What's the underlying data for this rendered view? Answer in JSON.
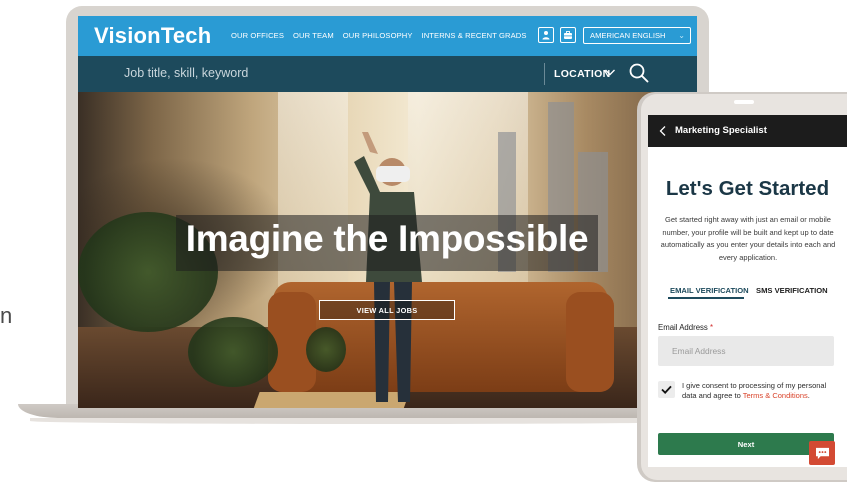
{
  "colors": {
    "nav_blue": "#2a9bd4",
    "search_bar": "#1d4a5c",
    "phone_title": "#1b3746",
    "next_button": "#2d7a4d",
    "terms_link": "#d9432a",
    "chat_button": "#d34a33"
  },
  "edge_glyph": "n",
  "website": {
    "logo": "VisionTech",
    "nav_links": [
      "OUR OFFICES",
      "OUR TEAM",
      "OUR PHILOSOPHY",
      "INTERNS & RECENT GRADS"
    ],
    "nav_icons": [
      "person-icon",
      "briefcase-icon"
    ],
    "language": "AMERICAN ENGLISH",
    "search_placeholder": "Job title, skill, keyword",
    "location_label": "LOCATION",
    "hero_headline": "Imagine the Impossible",
    "view_jobs_label": "VIEW ALL JOBS"
  },
  "phone": {
    "header_title": "Marketing Specialist",
    "title": "Let's Get Started",
    "description": "Get started right away with just an email or mobile number, your profile will be built and kept up to date automatically as you enter your details into each and every application.",
    "tabs": {
      "email": "EMAIL VERIFICATION",
      "sms": "SMS VERIFICATION",
      "active": "email"
    },
    "email_label": "Email Address",
    "required_marker": "*",
    "email_placeholder": "Email Address",
    "consent_checked": true,
    "consent_text": "I give consent to processing of my personal data and agree to ",
    "terms_link": "Terms & Conditions",
    "consent_suffix": ".",
    "next_label": "Next"
  }
}
